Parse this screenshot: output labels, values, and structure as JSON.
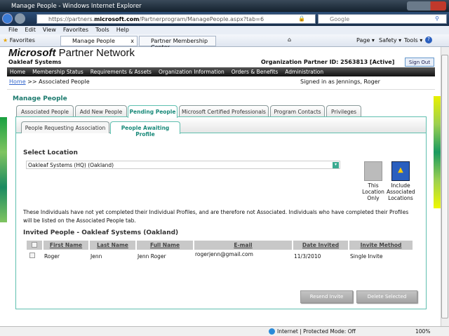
{
  "browser": {
    "title": "Manage People - Windows Internet Explorer",
    "url_prefix": "https://partners.",
    "url_domain": "microsoft.com",
    "url_path": "/Partnerprogram/ManagePeople.aspx?tab=6",
    "search_placeholder": "Google",
    "menu": [
      "File",
      "Edit",
      "View",
      "Favorites",
      "Tools",
      "Help"
    ],
    "favorites": "Favorites",
    "tabs": [
      "Manage People",
      "Partner Membership Center"
    ],
    "commands": [
      "Page ▾",
      "Safety ▾",
      "Tools ▾"
    ],
    "status": "Internet | Protected Mode: Off",
    "zoom": "100%"
  },
  "header": {
    "logo_bold": "Microsoft",
    "logo_rest": " Partner Network",
    "org": "Oakleaf Systems",
    "partner_id": "Organization Partner ID: 2563813 [Active]",
    "sign_out": "Sign Out"
  },
  "nav": [
    "Home",
    "Membership Status",
    "Requirements & Assets",
    "Organization Information",
    "Orders & Benefits",
    "Administration"
  ],
  "breadcrumb": {
    "home": "Home",
    "sep": " >> ",
    "current": "Associated People",
    "signed_in": "Signed in as Jennings, Roger"
  },
  "page_title": "Manage People",
  "tabs": [
    "Associated People",
    "Add New People",
    "Pending People",
    "Microsoft Certified Professionals",
    "Program Contacts",
    "Privileges"
  ],
  "subtabs": [
    "People Requesting Association",
    "People Awaiting Profile"
  ],
  "select_location": {
    "label": "Select Location",
    "value": "Oakleaf Systems (HQ) (Oakland)"
  },
  "location_options": {
    "this": "This Location Only",
    "include": "Include Associated Locations"
  },
  "info": "These Individuals have not yet completed their Individual Profiles, and are therefore not Associated. Individuals who have completed their Profiles will be listed on the Associated People tab.",
  "invited_heading": "Invited People - Oakleaf Systems (Oakland)",
  "table": {
    "columns": [
      "First Name",
      "Last Name",
      "Full Name",
      "E-mail",
      "Date Invited",
      "Invite Method"
    ],
    "rows": [
      [
        "Roger",
        "Jenn",
        "Jenn Roger",
        "rogerjenn@gmail.com",
        "11/3/2010",
        "Single Invite"
      ]
    ]
  },
  "buttons": {
    "resend": "Resend Invite",
    "delete": "Delete Selected"
  }
}
